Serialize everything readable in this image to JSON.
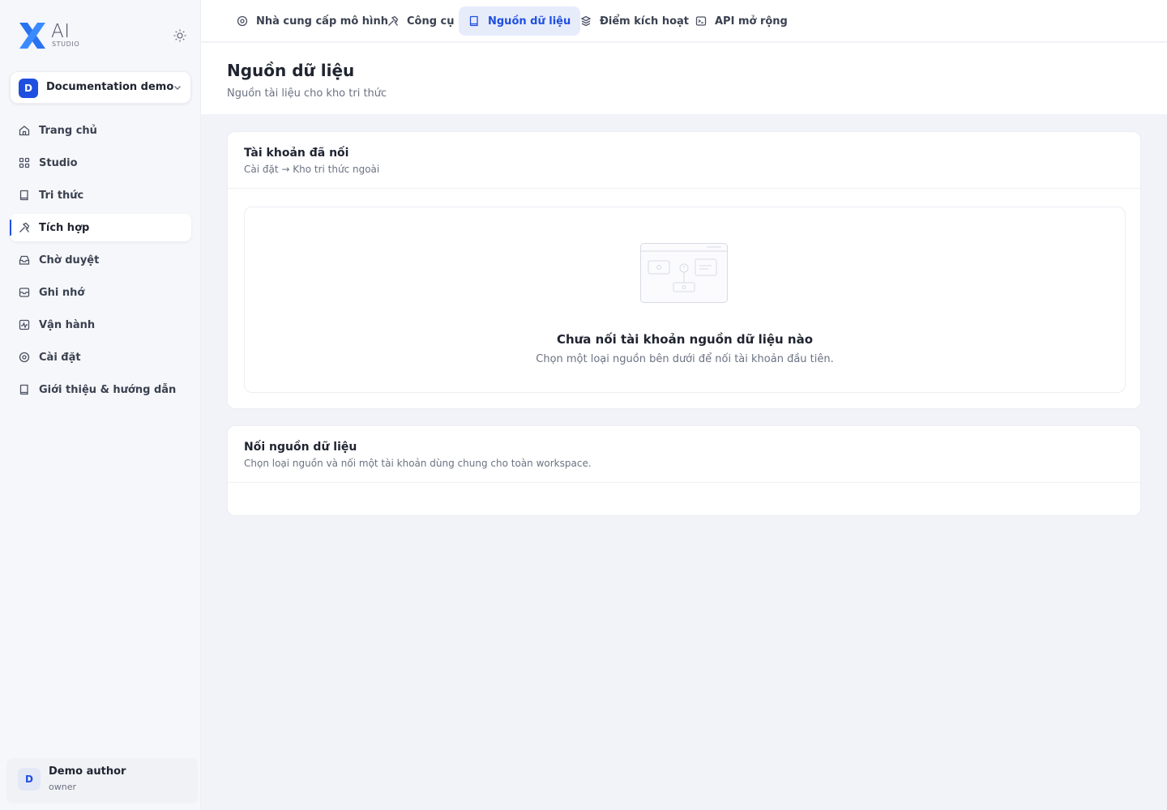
{
  "brand": {
    "logo_ai": "AI",
    "logo_sub": "STUDIO"
  },
  "workspace": {
    "initial": "D",
    "name": "Documentation demo"
  },
  "sidebar": {
    "items": [
      {
        "label": "Trang chủ",
        "icon": "home-icon"
      },
      {
        "label": "Studio",
        "icon": "grid-icon"
      },
      {
        "label": "Tri thức",
        "icon": "book-icon"
      },
      {
        "label": "Tích hợp",
        "icon": "tools-icon",
        "active": true
      },
      {
        "label": "Chờ duyệt",
        "icon": "inbox-icon"
      },
      {
        "label": "Ghi nhớ",
        "icon": "archive-icon"
      },
      {
        "label": "Vận hành",
        "icon": "pulse-icon"
      },
      {
        "label": "Cài đặt",
        "icon": "gear-icon"
      },
      {
        "label": "Giới thiệu & hướng dẫn",
        "icon": "guide-icon"
      }
    ]
  },
  "user": {
    "initial": "D",
    "name": "Demo author",
    "role": "owner"
  },
  "tabs": [
    {
      "label": "Nhà cung cấp mô hình",
      "icon": "provider-icon"
    },
    {
      "label": "Công cụ",
      "icon": "hammer-icon"
    },
    {
      "label": "Nguồn dữ liệu",
      "icon": "book-icon",
      "active": true
    },
    {
      "label": "Điểm kích hoạt",
      "icon": "trigger-icon"
    },
    {
      "label": "API mở rộng",
      "icon": "terminal-icon"
    }
  ],
  "header": {
    "title": "Nguồn dữ liệu",
    "subtitle": "Nguồn tài liệu cho kho tri thức"
  },
  "connected": {
    "title": "Tài khoản đã nối",
    "subtitle": "Cài đặt → Kho tri thức ngoài",
    "empty_title": "Chưa nối tài khoản nguồn dữ liệu nào",
    "empty_sub": "Chọn một loại nguồn bên dưới để nối tài khoản đầu tiên."
  },
  "connect": {
    "title": "Nối nguồn dữ liệu",
    "subtitle": "Chọn loại nguồn và nối một tài khoản dùng chung cho toàn workspace."
  },
  "colors": {
    "accent": "#1f4fe0",
    "active_tab_bg": "#e7ecfb"
  }
}
